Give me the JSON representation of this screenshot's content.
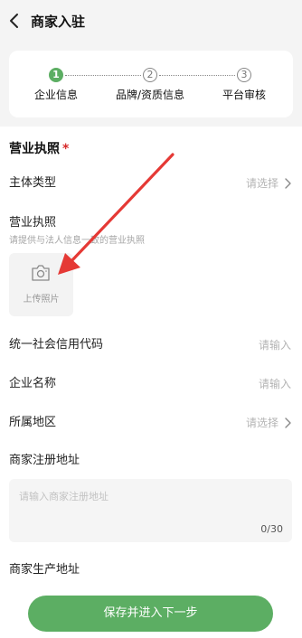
{
  "header": {
    "title": "商家入驻"
  },
  "steps": [
    {
      "number": "1",
      "label": "企业信息"
    },
    {
      "number": "2",
      "label": "品牌/资质信息"
    },
    {
      "number": "3",
      "label": "平台审核"
    }
  ],
  "form": {
    "section_title": "营业执照",
    "required_mark": "*",
    "entity_type": {
      "label": "主体类型",
      "value": "请选择"
    },
    "license": {
      "label": "营业执照",
      "hint": "请提供与法人信息一致的营业执照",
      "upload_text": "上传照片"
    },
    "credit_code": {
      "label": "统一社会信用代码",
      "placeholder": "请输入"
    },
    "company_name": {
      "label": "企业名称",
      "placeholder": "请输入"
    },
    "region": {
      "label": "所属地区",
      "value": "请选择"
    },
    "reg_address": {
      "label": "商家注册地址",
      "placeholder": "请输入商家注册地址",
      "counter": "0/30"
    },
    "prod_address": {
      "label": "商家生产地址"
    }
  },
  "footer": {
    "submit_label": "保存并进入下一步"
  },
  "colors": {
    "accent": "#5cae63",
    "required": "#d62828",
    "annotation_arrow": "#e53935"
  },
  "icons": [
    "chevron-left-icon",
    "chevron-right-icon",
    "camera-icon"
  ]
}
